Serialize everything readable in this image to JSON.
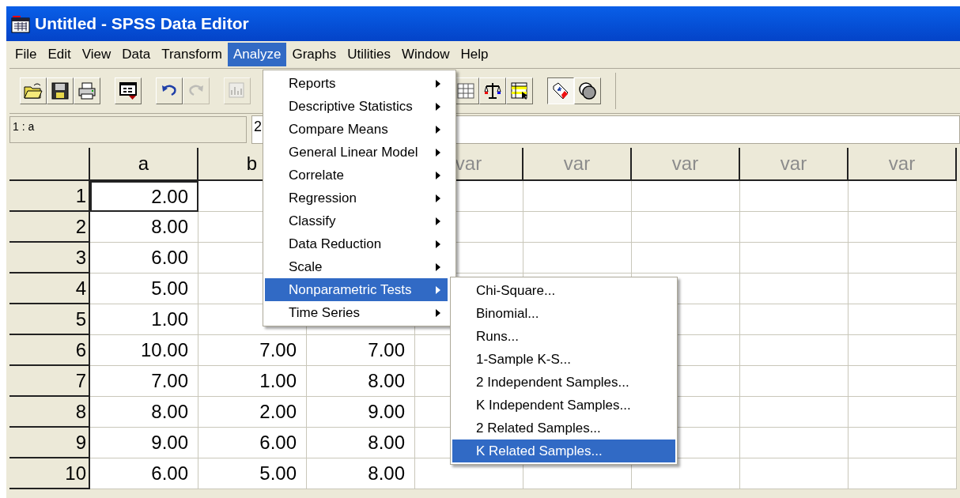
{
  "window": {
    "title": "Untitled - SPSS Data Editor"
  },
  "menubar": [
    {
      "label": "File",
      "selected": false
    },
    {
      "label": "Edit",
      "selected": false
    },
    {
      "label": "View",
      "selected": false
    },
    {
      "label": "Data",
      "selected": false
    },
    {
      "label": "Transform",
      "selected": false
    },
    {
      "label": "Analyze",
      "selected": true
    },
    {
      "label": "Graphs",
      "selected": false
    },
    {
      "label": "Utilities",
      "selected": false
    },
    {
      "label": "Window",
      "selected": false
    },
    {
      "label": "Help",
      "selected": false
    }
  ],
  "toolbar": [
    {
      "items": [
        {
          "kind": "open",
          "disabled": false,
          "pressed": false
        },
        {
          "kind": "save",
          "disabled": false,
          "pressed": false
        },
        {
          "kind": "print",
          "disabled": false,
          "pressed": false
        }
      ]
    },
    {
      "items": [
        {
          "kind": "dialog",
          "disabled": false,
          "pressed": false
        }
      ]
    },
    {
      "items": [
        {
          "kind": "undo",
          "disabled": false,
          "pressed": false
        },
        {
          "kind": "redo",
          "disabled": true,
          "pressed": false
        }
      ]
    },
    {
      "items": [
        {
          "kind": "chart",
          "disabled": true,
          "pressed": false
        }
      ]
    },
    {
      "items": [
        {
          "kind": "grid",
          "disabled": false,
          "pressed": false
        },
        {
          "kind": "scale",
          "disabled": false,
          "pressed": false
        },
        {
          "kind": "table",
          "disabled": false,
          "pressed": false
        }
      ]
    },
    {
      "items": [
        {
          "kind": "labels",
          "disabled": false,
          "pressed": true
        },
        {
          "kind": "sets",
          "disabled": false,
          "pressed": false
        }
      ]
    }
  ],
  "cell_info": {
    "cell": "1 : a",
    "value": "2"
  },
  "grid": {
    "columns": [
      "a",
      "b"
    ],
    "var_columns": [
      "var",
      "var",
      "var",
      "var",
      "var"
    ],
    "rows": [
      {
        "label": "1",
        "cells": [
          {
            "value": "2.00",
            "active": true
          }
        ]
      },
      {
        "label": "2",
        "cells": [
          {
            "value": "8.00",
            "active": false
          }
        ]
      },
      {
        "label": "3",
        "cells": [
          {
            "value": "6.00",
            "active": false
          }
        ]
      },
      {
        "label": "4",
        "cells": [
          {
            "value": "5.00",
            "active": false
          }
        ]
      },
      {
        "label": "5",
        "cells": [
          {
            "value": "1.00",
            "active": false
          }
        ]
      },
      {
        "label": "6",
        "cells": [
          {
            "value": "10.00",
            "active": false
          },
          {
            "value": "7.00",
            "active": false
          },
          {
            "value": "7.00",
            "active": false
          }
        ]
      },
      {
        "label": "7",
        "cells": [
          {
            "value": "7.00",
            "active": false
          },
          {
            "value": "1.00",
            "active": false
          },
          {
            "value": "8.00",
            "active": false
          }
        ]
      },
      {
        "label": "8",
        "cells": [
          {
            "value": "8.00",
            "active": false
          },
          {
            "value": "2.00",
            "active": false
          },
          {
            "value": "9.00",
            "active": false
          }
        ]
      },
      {
        "label": "9",
        "cells": [
          {
            "value": "9.00",
            "active": false
          },
          {
            "value": "6.00",
            "active": false
          },
          {
            "value": "8.00",
            "active": false
          }
        ]
      },
      {
        "label": "10",
        "cells": [
          {
            "value": "6.00",
            "active": false
          },
          {
            "value": "5.00",
            "active": false
          },
          {
            "value": "8.00",
            "active": false
          }
        ]
      }
    ]
  },
  "analyze_menu": [
    {
      "label": "Reports",
      "selected": false
    },
    {
      "label": "Descriptive Statistics",
      "selected": false
    },
    {
      "label": "Compare Means",
      "selected": false
    },
    {
      "label": "General Linear Model",
      "selected": false
    },
    {
      "label": "Correlate",
      "selected": false
    },
    {
      "label": "Regression",
      "selected": false
    },
    {
      "label": "Classify",
      "selected": false
    },
    {
      "label": "Data Reduction",
      "selected": false
    },
    {
      "label": "Scale",
      "selected": false
    },
    {
      "label": "Nonparametric Tests",
      "selected": true
    },
    {
      "label": "Time Series",
      "selected": false
    }
  ],
  "submenu": [
    {
      "label": "Chi-Square...",
      "selected": false
    },
    {
      "label": "Binomial...",
      "selected": false
    },
    {
      "label": "Runs...",
      "selected": false
    },
    {
      "label": "1-Sample K-S...",
      "selected": false
    },
    {
      "label": "2 Independent Samples...",
      "selected": false
    },
    {
      "label": "K Independent Samples...",
      "selected": false
    },
    {
      "label": "2 Related Samples...",
      "selected": false
    },
    {
      "label": "K Related Samples...",
      "selected": true
    }
  ]
}
